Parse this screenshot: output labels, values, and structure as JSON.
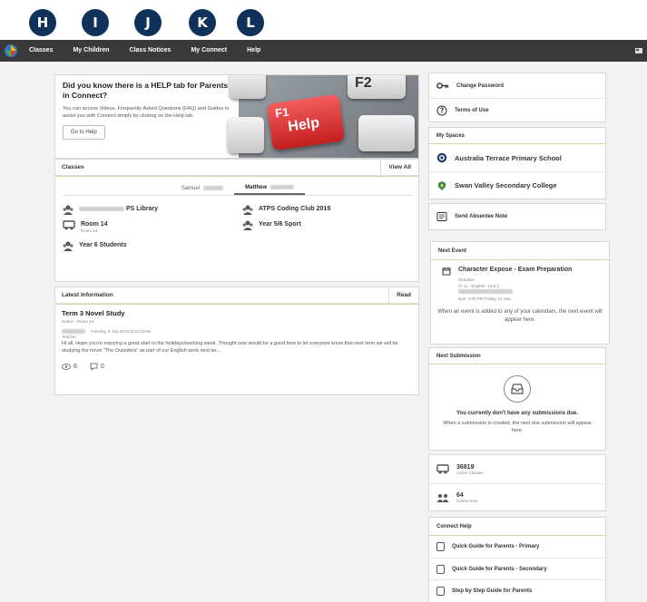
{
  "callouts": [
    "H",
    "I",
    "J",
    "K",
    "L"
  ],
  "nav": {
    "items": [
      "Classes",
      "My Children",
      "Class Notices",
      "My Connect",
      "Help"
    ]
  },
  "help_banner": {
    "title": "Did you know there is a HELP tab for Parents in Connect?",
    "description": "You can access Videos, Frequently Asked Questions (FAQ) and Guides to assist you with Connect simply by clicking on the Help tab.",
    "button": "Go to Help",
    "key_f1": "F1",
    "key_help": "Help",
    "key_f2": "F2"
  },
  "classes": {
    "title": "Classes",
    "view_all": "View All",
    "tabs": [
      "Samuel",
      "Matthew"
    ],
    "items": [
      {
        "name": "PS Library",
        "sub": ""
      },
      {
        "name": "ATPS Coding Club 2019",
        "sub": ""
      },
      {
        "name": "Room 14",
        "sub": "Room 14"
      },
      {
        "name": "Year 5/6 Sport",
        "sub": ""
      },
      {
        "name": "Year 6 Students",
        "sub": ""
      }
    ]
  },
  "latest": {
    "title": "Latest Information",
    "read": "Read",
    "post_title": "Term 3 Novel Study",
    "post_sub": "Notice - Room 14",
    "post_meta": "- Tuesday, 9 July 2019 @10:12AM",
    "post_role": "Teacher",
    "post_body": "Hi all, Hope you're enjoying a great start to the holidays/working week. Thought now would be a good time to let everyone know that next term we will be studying the novel \"The Outsiders\" as part of our English work next ter...",
    "views": "6",
    "comments": "0"
  },
  "account": {
    "change_password": "Change Password",
    "terms": "Terms of Use"
  },
  "spaces": {
    "title": "My Spaces",
    "items": [
      "Australia Terrace Primary School",
      "Swan Valley Secondary College"
    ]
  },
  "absence": {
    "label": "Send Absentee Note"
  },
  "next_event": {
    "title": "Next Event",
    "event_title": "Character Expose - Exam Preparation",
    "deadline": "Deadline",
    "course": "Yr 11 - English - Unit 1",
    "due": "Due: 3:00 PM Friday, 21 Sep",
    "footer": "When an event is added to any of your calendars, the next event will appear here."
  },
  "next_submission": {
    "title": "Next Submission",
    "none": "You currently don't have any submissions due.",
    "desc": "When a submission is created, the next due submission will appear here."
  },
  "stats": {
    "active_classes_num": "36819",
    "active_classes_label": "Active Classes",
    "online_num": "64",
    "online_label": "Online Now"
  },
  "connect_help": {
    "title": "Connect Help",
    "items": [
      "Quick Guide for Parents - Primary",
      "Quick Guide for Parents - Secondary",
      "Step by Step Guide for Parents"
    ]
  },
  "colors": {
    "nav_bg": "#3a3a3a",
    "callout_bg": "#10325a",
    "accent_line": "#cddc9a",
    "help_key_red": "#d83030"
  }
}
